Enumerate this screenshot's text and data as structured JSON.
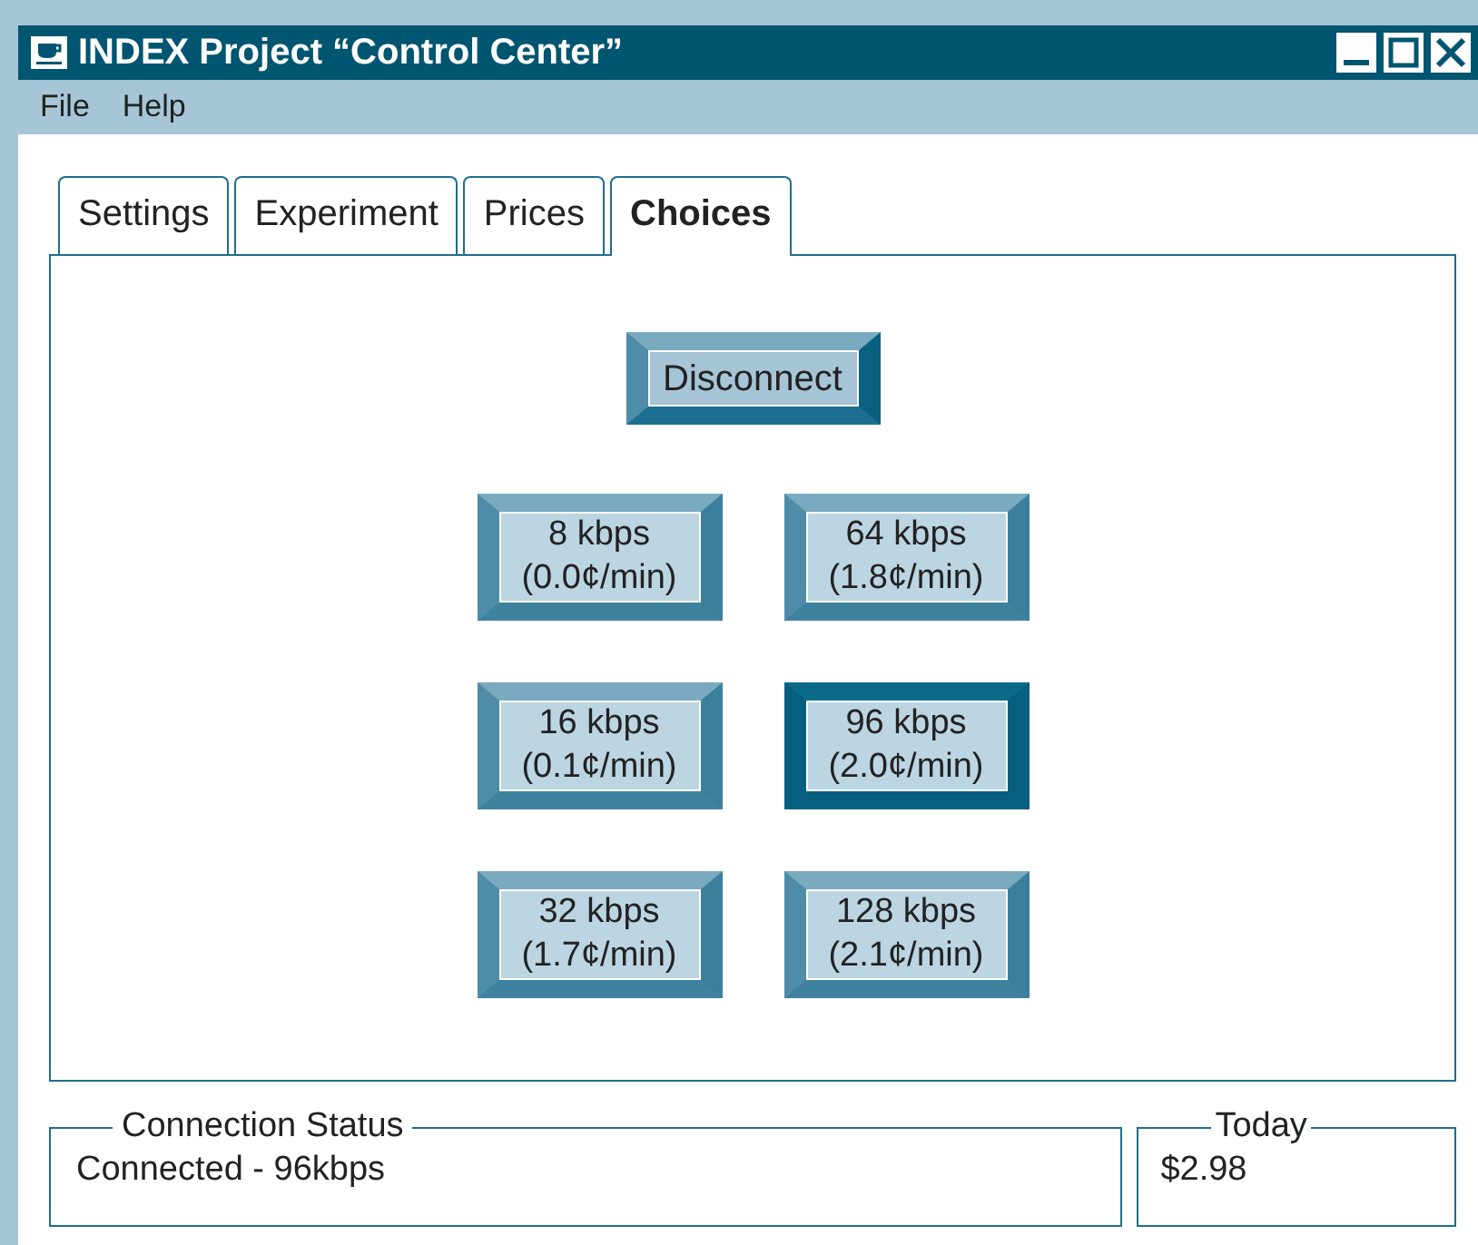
{
  "window": {
    "title": "INDEX Project “Control Center”"
  },
  "menu": [
    "File",
    "Help"
  ],
  "tabs": [
    {
      "label": "Settings",
      "selected": false
    },
    {
      "label": "Experiment",
      "selected": false
    },
    {
      "label": "Prices",
      "selected": false
    },
    {
      "label": "Choices",
      "selected": true
    }
  ],
  "disconnect_button": "Disconnect",
  "rates": [
    {
      "speed": "8 kbps",
      "price": "(0.0¢/min)",
      "selected": false
    },
    {
      "speed": "64 kbps",
      "price": "(1.8¢/min)",
      "selected": false
    },
    {
      "speed": "16 kbps",
      "price": "(0.1¢/min)",
      "selected": false
    },
    {
      "speed": "96 kbps",
      "price": "(2.0¢/min)",
      "selected": true
    },
    {
      "speed": "32 kbps",
      "price": "(1.7¢/min)",
      "selected": false
    },
    {
      "speed": "128 kbps",
      "price": "(2.1¢/min)",
      "selected": false
    }
  ],
  "connection_status": {
    "legend": "Connection Status",
    "value": "Connected - 96kbps"
  },
  "today": {
    "legend": "Today",
    "value": "$2.98"
  }
}
